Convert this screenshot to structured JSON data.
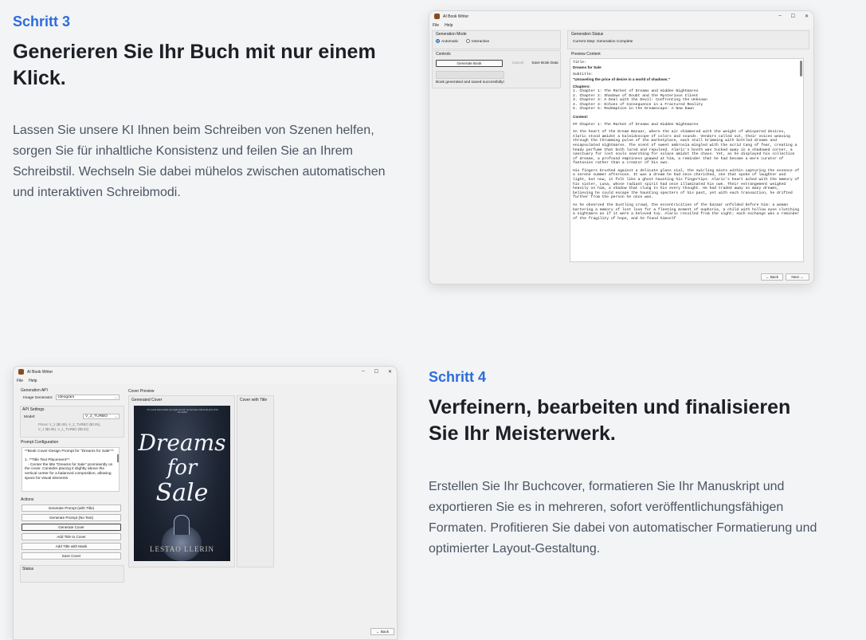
{
  "step3": {
    "label": "Schritt 3",
    "heading": "Generieren Sie Ihr Buch mit nur einem Klick.",
    "description": "Lassen Sie unsere KI Ihnen beim Schreiben von Szenen helfen, sorgen Sie für inhaltliche Konsistenz und feilen Sie an Ihrem Schreibstil. Wechseln Sie dabei mühelos zwischen automatischen und interaktiven Schreibmodi."
  },
  "step4": {
    "label": "Schritt 4",
    "heading": "Verfeinern, bearbeiten und finalisieren Sie Ihr Meisterwerk.",
    "description": "Erstellen Sie Ihr Buchcover, formatieren Sie Ihr Manuskript und exportieren Sie es in mehreren, sofort veröffentlichungsfähigen Formaten. Profitieren Sie dabei von automatischer Formatierung und optimierter Layout-Gestaltung."
  },
  "window1": {
    "title": "AI Book Writer",
    "controls": {
      "minimize": "–",
      "maximize": "☐",
      "close": "✕"
    },
    "menu": [
      "File",
      "Help"
    ],
    "generation_mode": {
      "label": "Generation Mode",
      "options": [
        "Automatic",
        "Interactive"
      ],
      "selected": "Automatic"
    },
    "controls_group": {
      "label": "Controls",
      "generate": "Generate Book",
      "cancel": "Cancel",
      "save": "Save Book Data",
      "status": "Book generated and saved successfully!"
    },
    "generation_status": {
      "label": "Generation Status",
      "current": "Current Step: Generation Complete"
    },
    "preview": {
      "label": "Preview Content",
      "title_label": "Title:",
      "title": "Dreams for Sale",
      "subtitle_label": "Subtitle:",
      "subtitle": "\"Unraveling the price of desire in a world of shadows.\"",
      "chapters_label": "Chapters:",
      "chapters": [
        "1. Chapter 1: The Market of Dreams and Hidden Nightmares",
        "2. Chapter 2: Shadows of Doubt and the Mysterious Client",
        "3. Chapter 3: A Deal with the Devil: Confronting the Unknown",
        "4. Chapter 4: Echoes of Consequence in a Fractured Reality",
        "5. Chapter 5: Redemption in the Dreamscape: A New Dawn"
      ],
      "content_label": "Content:",
      "chapter_heading": "## Chapter 1: The Market of Dreams and Hidden Nightmares",
      "paragraphs": [
        "In the heart of the Dream Bazaar, where the air shimmered with the weight of whispered desires, Alaric stood amidst a kaleidoscope of colors and sounds. Vendors called out, their voices weaving through the thrumming pulse of the marketplace, each stall brimming with bottled dreams and encapsulated nightmares. The scent of sweet ambrosia mingled with the acrid tang of fear, creating a heady perfume that both lured and repulsed. Alaric's booth was tucked away in a shadowed corner, a sanctuary for lost souls searching for solace amidst the chaos. Yet, as he displayed his collection of dreams, a profound emptiness gnawed at him, a reminder that he had become a mere curator of fantasies rather than a creator of his own.",
        "His fingers brushed against a delicate glass vial, the swirling mists within capturing the essence of a serene summer afternoon. It was a dream he had once cherished, one that spoke of laughter and light, but now, it felt like a ghost haunting his fingertips. Alaric's heart ached with the memory of his sister, Luna, whose radiant spirit had once illuminated his own. Their estrangement weighed heavily on him, a shadow that clung to his every thought. He had traded away so many dreams, believing he could escape the haunting specters of his past, yet with each transaction, he drifted further from the person he once was.",
        "As he observed the bustling crowd, the eccentricities of the bazaar unfolded before him: a woman bartering a memory of lost love for a fleeting moment of euphoria, a child with hollow eyes clutching a nightmare as if it were a beloved toy. Alaric recoiled from the sight; each exchange was a reminder of the fragility of hope, and he found himself"
      ]
    },
    "nav": {
      "back": "← Back",
      "next": "Next →"
    }
  },
  "window2": {
    "title": "AI Book Writer",
    "controls": {
      "minimize": "–",
      "maximize": "☐",
      "close": "✕"
    },
    "menu": [
      "File",
      "Help"
    ],
    "generation_api": {
      "label": "Generation API",
      "field_label": "Image Generator:",
      "value": "Ideogram"
    },
    "api_settings": {
      "label": "API Settings",
      "model_label": "Model:",
      "model_value": "V_2_TURBO",
      "prices_line1": "Prices: V_2 ($0.08), V_2_TURBO ($0.05),",
      "prices_line2": "V_1 ($0.06), V_1_TURBO ($0.02)"
    },
    "prompt_config": {
      "label": "Prompt Configuration",
      "text": "**Book Cover Design Prompt for \"Dreams for Sale\"**\n\n1. **Title Text Placement**:\n   - Center the title \"Dreams for Sale\" prominently on the cover. Consider placing it slightly above the vertical center for a balanced composition, allowing space for visual elements"
    },
    "actions": {
      "label": "Actions",
      "buttons": [
        "Generate Prompt (with Title)",
        "Generate Prompt (No Text)",
        "Generate Cover",
        "Add Title to Cover",
        "Add Title with Mask",
        "Save Cover"
      ]
    },
    "status_label": "Status",
    "cover_preview": {
      "label": "Cover Preview",
      "generated_label": "Generated Cover",
      "with_title_label": "Cover with Title",
      "cover_tagline": "\"In a world where dreams are bought and sold, one man must confront the price of his own desires\"",
      "cover_title_1": "Dreams",
      "cover_title_2": "for",
      "cover_title_3": "Sale",
      "cover_author": "LESTAO  LLERIN"
    },
    "nav": {
      "back": "← Back"
    }
  },
  "colors": {
    "accent": "#2b6cde",
    "heading": "#1c1f24",
    "body": "#4b5563",
    "background": "#f3f4f6"
  }
}
